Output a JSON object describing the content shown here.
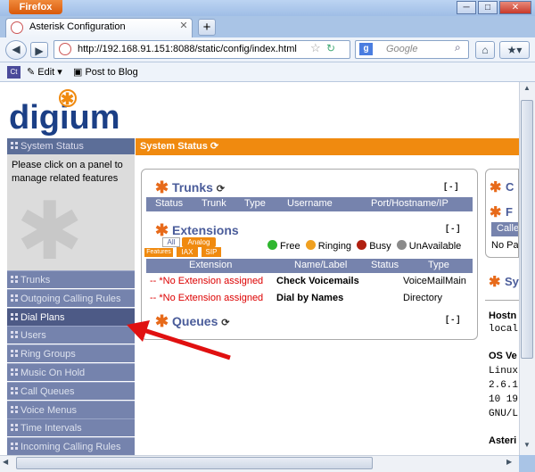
{
  "browser": {
    "app_button": "Firefox",
    "tab_title": "Asterisk Configuration",
    "new_tab": "+",
    "url": "http://192.168.91.151:8088/static/config/index.html",
    "search_placeholder": "Google",
    "bookmarks": {
      "edit": "Edit",
      "post": "Post to Blog"
    }
  },
  "logo": "digium",
  "sidebar": {
    "header": "System Status",
    "help": "Please click on a panel to manage related features",
    "items": [
      {
        "label": "Trunks"
      },
      {
        "label": "Outgoing Calling Rules"
      },
      {
        "label": "Dial Plans"
      },
      {
        "label": "Users"
      },
      {
        "label": "Ring Groups"
      },
      {
        "label": "Music On Hold"
      },
      {
        "label": "Call Queues"
      },
      {
        "label": "Voice Menus"
      },
      {
        "label": "Time Intervals"
      },
      {
        "label": "Incoming Calling Rules"
      }
    ]
  },
  "main": {
    "header": "System Status",
    "trunks": {
      "title": "Trunks",
      "collapse": "[ - ]",
      "columns": [
        "Status",
        "Trunk",
        "Type",
        "Username",
        "Port/Hostname/IP"
      ]
    },
    "extensions": {
      "title": "Extensions",
      "collapse": "[ - ]",
      "filters": [
        "All",
        "Analog",
        "Features",
        "IAX",
        "SIP"
      ],
      "legend": [
        "Free",
        "Ringing",
        "Busy",
        "UnAvailable"
      ],
      "columns": [
        "Extension",
        "Name/Label",
        "Status",
        "Type"
      ],
      "rows": [
        {
          "ext": "-- *No Extension assigned",
          "name": "Check Voicemails",
          "status": "",
          "type": "VoiceMailMain"
        },
        {
          "ext": "-- *No Extension assigned",
          "name": "Dial by Names",
          "status": "",
          "type": "Directory"
        }
      ]
    },
    "queues": {
      "title": "Queues",
      "collapse": "[ - ]"
    }
  },
  "right": {
    "top_labels": [
      "C",
      "F",
      "Calle",
      "No Pa"
    ],
    "sys_title": "Sy",
    "lines": [
      "Hostn",
      "local",
      "OS Ve",
      "Linux",
      "2.6.1",
      "10 19",
      "GNU/L",
      "Asteri"
    ]
  },
  "colors": {
    "accent": "#f08a0f",
    "nav": "#7583ad",
    "nav_selected": "#4d5a86",
    "arrow": "#e01010"
  }
}
